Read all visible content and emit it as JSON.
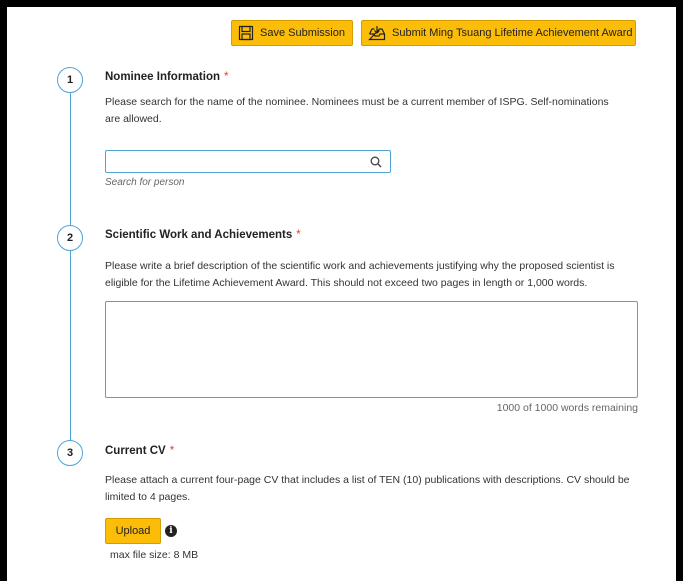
{
  "toolbar": {
    "save_label": "Save Submission",
    "submit_label": "Submit Ming Tsuang Lifetime Achievement Award",
    "save_icon": "save-icon",
    "submit_icon": "inbox-submit-icon"
  },
  "required_marker": "*",
  "sections": [
    {
      "number": "1",
      "title": "Nominee Information",
      "description": "Please search for the name of the nominee. Nominees must be a current member of ISPG. Self-nominations are allowed.",
      "search_value": "",
      "search_hint": "Search for person"
    },
    {
      "number": "2",
      "title": "Scientific Work and Achievements",
      "description": "Please write a brief description of the scientific work and achievements justifying why the proposed scientist is eligible for the Lifetime Achievement Award. This should not exceed two pages in length or 1,000 words.",
      "text_value": "",
      "word_counter": "1000 of 1000 words remaining"
    },
    {
      "number": "3",
      "title": "Current CV",
      "description": "Please attach a current four-page CV that includes a list of TEN (10) publications with descriptions. CV should be limited to 4 pages.",
      "upload_label": "Upload",
      "info_glyph": "i",
      "max_size": "max file size: 8 MB"
    }
  ],
  "colors": {
    "accent_yellow": "#fbbd08",
    "timeline_blue": "#4fa4d8",
    "required_red": "#e0412f"
  }
}
